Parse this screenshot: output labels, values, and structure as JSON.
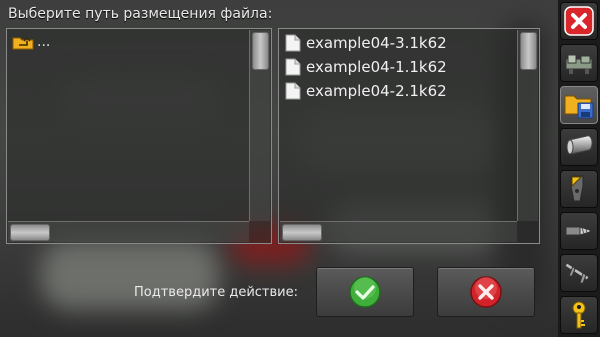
{
  "dialog": {
    "title": "Выберите путь размещения файла:",
    "parent_dir_label": "...",
    "files": [
      {
        "name": "example04-3.1k62"
      },
      {
        "name": "example04-1.1k62"
      },
      {
        "name": "example04-2.1k62"
      }
    ],
    "confirm_label": "Подтвердите действие:",
    "ok_icon": "checkmark-icon",
    "cancel_icon": "cross-icon"
  },
  "sidebar": {
    "items": [
      {
        "icon": "close-icon",
        "active": false
      },
      {
        "icon": "machine-icon",
        "active": false
      },
      {
        "icon": "folder-save-icon",
        "active": true
      },
      {
        "icon": "cylinder-stock-icon",
        "active": false
      },
      {
        "icon": "tool-insert-icon",
        "active": false
      },
      {
        "icon": "drill-icon",
        "active": false
      },
      {
        "icon": "caliper-icon",
        "active": false
      },
      {
        "icon": "key-icon",
        "active": false
      }
    ]
  },
  "colors": {
    "close_red": "#d8262a",
    "ok_green": "#3fae3a",
    "cancel_red": "#d2232a",
    "folder_yellow": "#f0b020",
    "key_yellow": "#f2c21a"
  }
}
